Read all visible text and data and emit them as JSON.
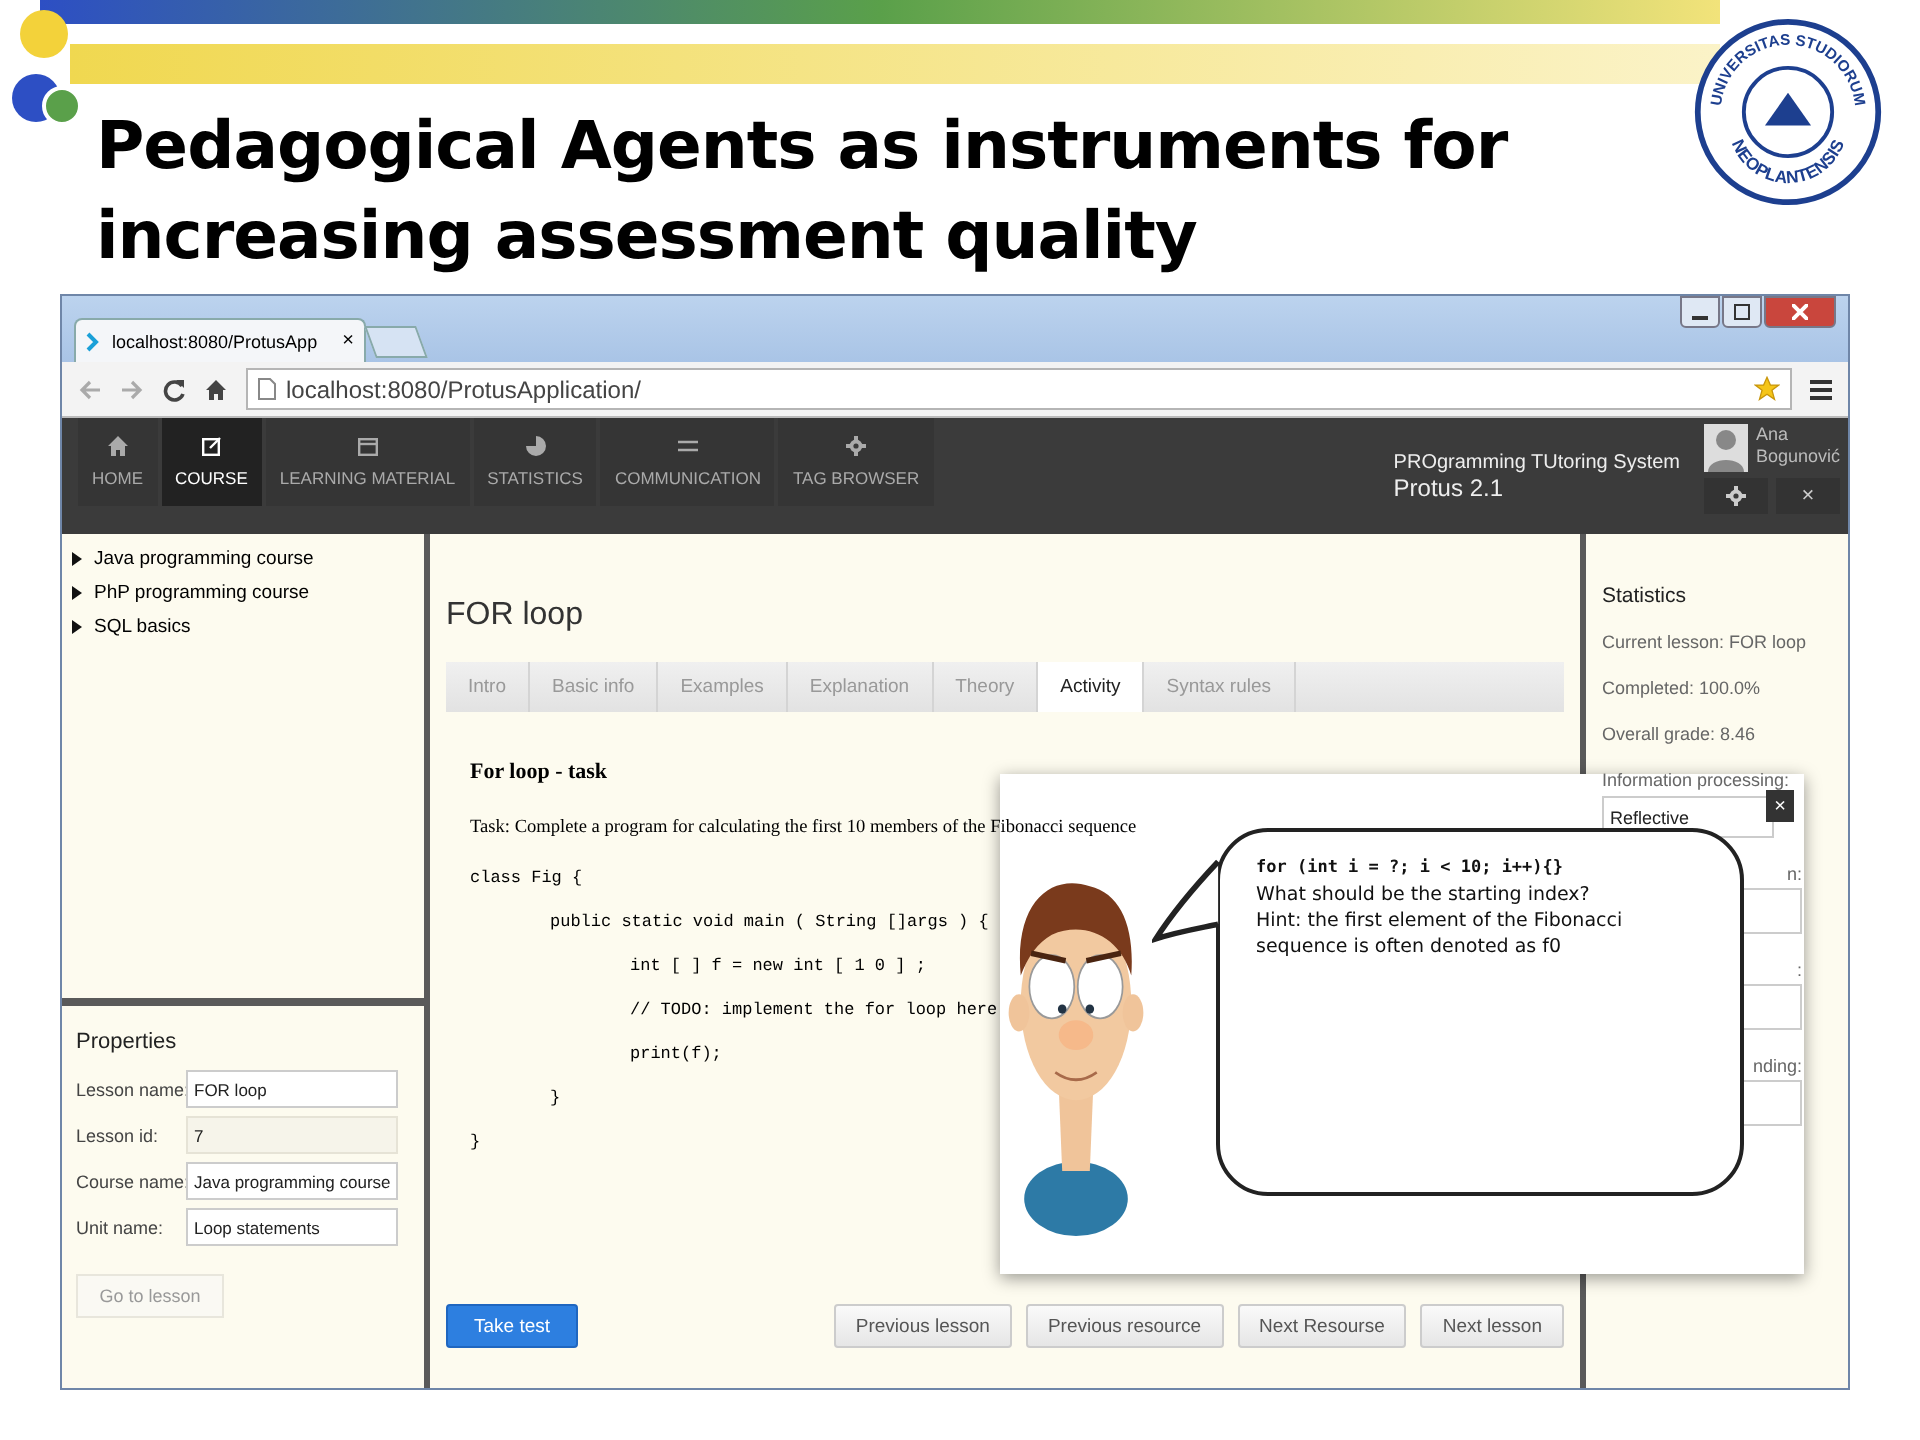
{
  "slide": {
    "title": "Pedagogical Agents as instruments for increasing assessment quality",
    "seal_top": "UNIVERSITAS STUDIORUM",
    "seal_bottom": "NEOPLANTENSIS"
  },
  "browser": {
    "tab": "localhost:8080/ProtusApp",
    "tab_close": "×",
    "url": "localhost:8080/ProtusApplication/"
  },
  "nav": {
    "items": [
      {
        "label": "HOME",
        "kind": "home",
        "selected": false
      },
      {
        "label": "COURSE",
        "kind": "edit",
        "selected": true
      },
      {
        "label": "LEARNING MATERIAL",
        "kind": "calendar",
        "selected": false
      },
      {
        "label": "STATISTICS",
        "kind": "chart",
        "selected": false
      },
      {
        "label": "COMMUNICATION",
        "kind": "exchange",
        "selected": false
      },
      {
        "label": "TAG BROWSER",
        "kind": "gear",
        "selected": false
      }
    ],
    "system_name": "PROgramming TUtoring System",
    "version": "Protus 2.1",
    "user": "Ana Bogunović",
    "close": "×"
  },
  "course_tree": [
    {
      "label": "Java programming course",
      "expanded": false
    },
    {
      "label": "PhP programming course",
      "expanded": false
    },
    {
      "label": "SQL basics",
      "expanded": false
    }
  ],
  "properties": {
    "title": "Properties",
    "fields": [
      {
        "label": "Lesson name:",
        "value": "FOR loop",
        "disabled": false
      },
      {
        "label": "Lesson id:",
        "value": "7",
        "disabled": true
      },
      {
        "label": "Course name:",
        "value": "Java programming course",
        "disabled": false
      },
      {
        "label": "Unit name:",
        "value": "Loop statements",
        "disabled": false
      }
    ],
    "button": {
      "label": "Go to lesson",
      "disabled": true
    }
  },
  "lesson": {
    "title": "FOR loop",
    "tabs": [
      {
        "label": "Intro",
        "selected": false
      },
      {
        "label": "Basic info",
        "selected": false
      },
      {
        "label": "Examples",
        "selected": false
      },
      {
        "label": "Explanation",
        "selected": false
      },
      {
        "label": "Theory",
        "selected": false
      },
      {
        "label": "Activity",
        "selected": true
      },
      {
        "label": "Syntax rules",
        "selected": false
      }
    ],
    "task_title": "For loop - task",
    "task_text": "Task: Complete a program for calculating the first 10 members of the Fibonacci sequence",
    "code": [
      {
        "text": "class Fig {",
        "children": [
          {
            "text": "public static void main ( String []args ) {",
            "children": [
              {
                "text": "int [ ] f = new int [ 1 0 ] ;"
              },
              {
                "text": "// TODO: implement the for loop here"
              },
              {
                "text": "print(f);"
              }
            ]
          },
          {
            "text": "}"
          }
        ]
      },
      {
        "text": "}"
      }
    ],
    "buttons": [
      {
        "label": "Take test",
        "kind": "primary"
      },
      {
        "label": "Previous lesson",
        "kind": "default"
      },
      {
        "label": "Previous resource",
        "kind": "default"
      },
      {
        "label": "Next Resourse",
        "kind": "default"
      },
      {
        "label": "Next lesson",
        "kind": "default"
      }
    ]
  },
  "statistics": {
    "title": "Statistics",
    "lines": [
      "Current lesson: FOR loop",
      "Completed: 100.0%",
      "Overall grade: 8.46"
    ],
    "processing_label": "Information processing:",
    "processing_value": "Reflective",
    "covered_fields": [
      {
        "label": "n:"
      },
      {
        "label": ":"
      },
      {
        "label": "nding:"
      }
    ]
  },
  "agent_popup": {
    "close": "×",
    "code_line": "for (int i = ?; i < 10; i++){}",
    "message": "What should be the starting index?",
    "hint": "Hint: the first element of the Fibonacci sequence is often denoted as f0"
  }
}
